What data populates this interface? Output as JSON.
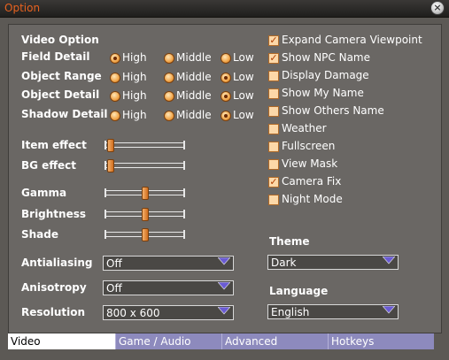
{
  "window": {
    "title": "Option",
    "close_icon": "close-icon"
  },
  "video_section": {
    "heading": "Video Option",
    "radio_rows": [
      {
        "label": "Field Detail",
        "options": [
          "High",
          "Middle",
          "Low"
        ],
        "selected": "High"
      },
      {
        "label": "Object Range",
        "options": [
          "High",
          "Middle",
          "Low"
        ],
        "selected": "Low"
      },
      {
        "label": "Object Detail",
        "options": [
          "High",
          "Middle",
          "Low"
        ],
        "selected": "Low"
      },
      {
        "label": "Shadow Detail",
        "options": [
          "High",
          "Middle",
          "Low"
        ],
        "selected": "Low"
      }
    ],
    "effect_sliders": [
      {
        "label": "Item effect",
        "value": 0.0
      },
      {
        "label": "BG effect",
        "value": 0.0
      }
    ],
    "display_sliders": [
      {
        "label": "Gamma",
        "value": 0.5
      },
      {
        "label": "Brightness",
        "value": 0.5
      },
      {
        "label": "Shade",
        "value": 0.5
      }
    ],
    "selects": [
      {
        "label": "Antialiasing",
        "value": "Off"
      },
      {
        "label": "Anisotropy",
        "value": "Off"
      },
      {
        "label": "Resolution",
        "value": "800 x 600"
      }
    ]
  },
  "checkboxes": [
    {
      "label": "Expand Camera Viewpoint",
      "checked": true
    },
    {
      "label": "Show NPC Name",
      "checked": true
    },
    {
      "label": "Display Damage",
      "checked": false
    },
    {
      "label": "Show My Name",
      "checked": false
    },
    {
      "label": "Show Others Name",
      "checked": false
    },
    {
      "label": "Weather",
      "checked": false
    },
    {
      "label": "Fullscreen",
      "checked": false
    },
    {
      "label": "View Mask",
      "checked": false
    },
    {
      "label": "Camera Fix",
      "checked": true
    },
    {
      "label": "Night Mode",
      "checked": false
    }
  ],
  "theme": {
    "label": "Theme",
    "value": "Dark"
  },
  "language": {
    "label": "Language",
    "value": "English"
  },
  "tabs": [
    {
      "label": "Video",
      "active": true
    },
    {
      "label": "Game / Audio",
      "active": false
    },
    {
      "label": "Advanced",
      "active": false
    },
    {
      "label": "Hotkeys",
      "active": false
    }
  ],
  "colors": {
    "title_orange": "#e8621f",
    "radio_orange": "#f0a448",
    "tab_bar": "#8d8abd",
    "panel_bg": "#6a6764",
    "arrow_purple": "#6a5bd4"
  }
}
